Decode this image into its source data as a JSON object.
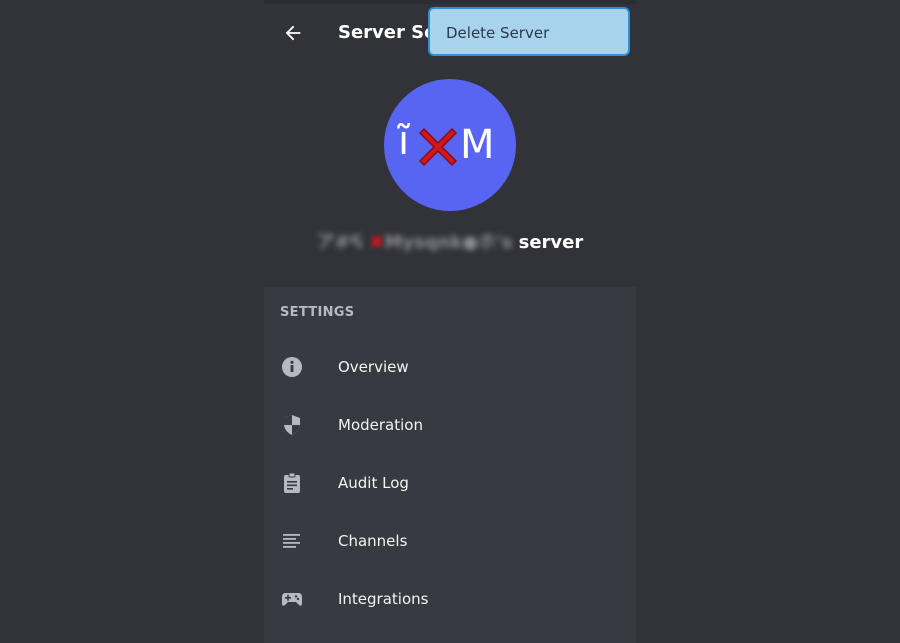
{
  "header": {
    "back_icon": "arrow-left-icon",
    "title": "Server Settings"
  },
  "context_menu": {
    "items": [
      {
        "label": "Delete Server"
      }
    ]
  },
  "server": {
    "avatar_text_left": "ĩ",
    "avatar_text_right": "M",
    "avatar_color": "#5865f2",
    "name_blurred": "ア#ᕋ ",
    "name_blurred_mid": "Mysqnk●ホ's",
    "name_suffix": "server"
  },
  "settings": {
    "section_label": "SETTINGS",
    "items": [
      {
        "label": "Overview",
        "icon": "info-icon"
      },
      {
        "label": "Moderation",
        "icon": "shield-icon"
      },
      {
        "label": "Audit Log",
        "icon": "clipboard-icon"
      },
      {
        "label": "Channels",
        "icon": "list-icon"
      },
      {
        "label": "Integrations",
        "icon": "gamepad-icon"
      }
    ]
  },
  "colors": {
    "background": "#313338",
    "panel": "#383a42",
    "accent": "#5865f2",
    "popup_bg": "#a8d3ed",
    "popup_border": "#2e8fdb"
  }
}
